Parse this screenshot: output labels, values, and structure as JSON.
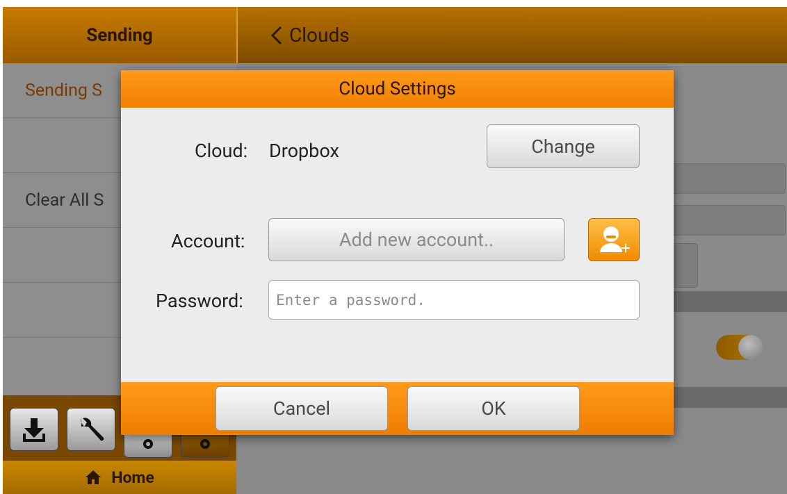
{
  "left_panel": {
    "title": "Sending",
    "items": [
      {
        "label": "Sending S"
      },
      {
        "label": ""
      },
      {
        "label": "Clear All S"
      },
      {
        "label": ""
      },
      {
        "label": ""
      },
      {
        "label": ""
      }
    ],
    "toolbar": [
      "download-icon",
      "wrench-icon",
      "gear-icon",
      "gear-icon"
    ],
    "home_label": "Home"
  },
  "right_panel": {
    "back_label": "Clouds"
  },
  "dialog": {
    "title": "Cloud Settings",
    "cloud_label": "Cloud:",
    "cloud_value": "Dropbox",
    "change_label": "Change",
    "account_label": "Account:",
    "account_button": "Add new account..",
    "password_label": "Password:",
    "password_placeholder": "Enter a password.",
    "cancel_label": "Cancel",
    "ok_label": "OK"
  },
  "colors": {
    "accent": "#f08a00",
    "header": "#9a5a00"
  }
}
